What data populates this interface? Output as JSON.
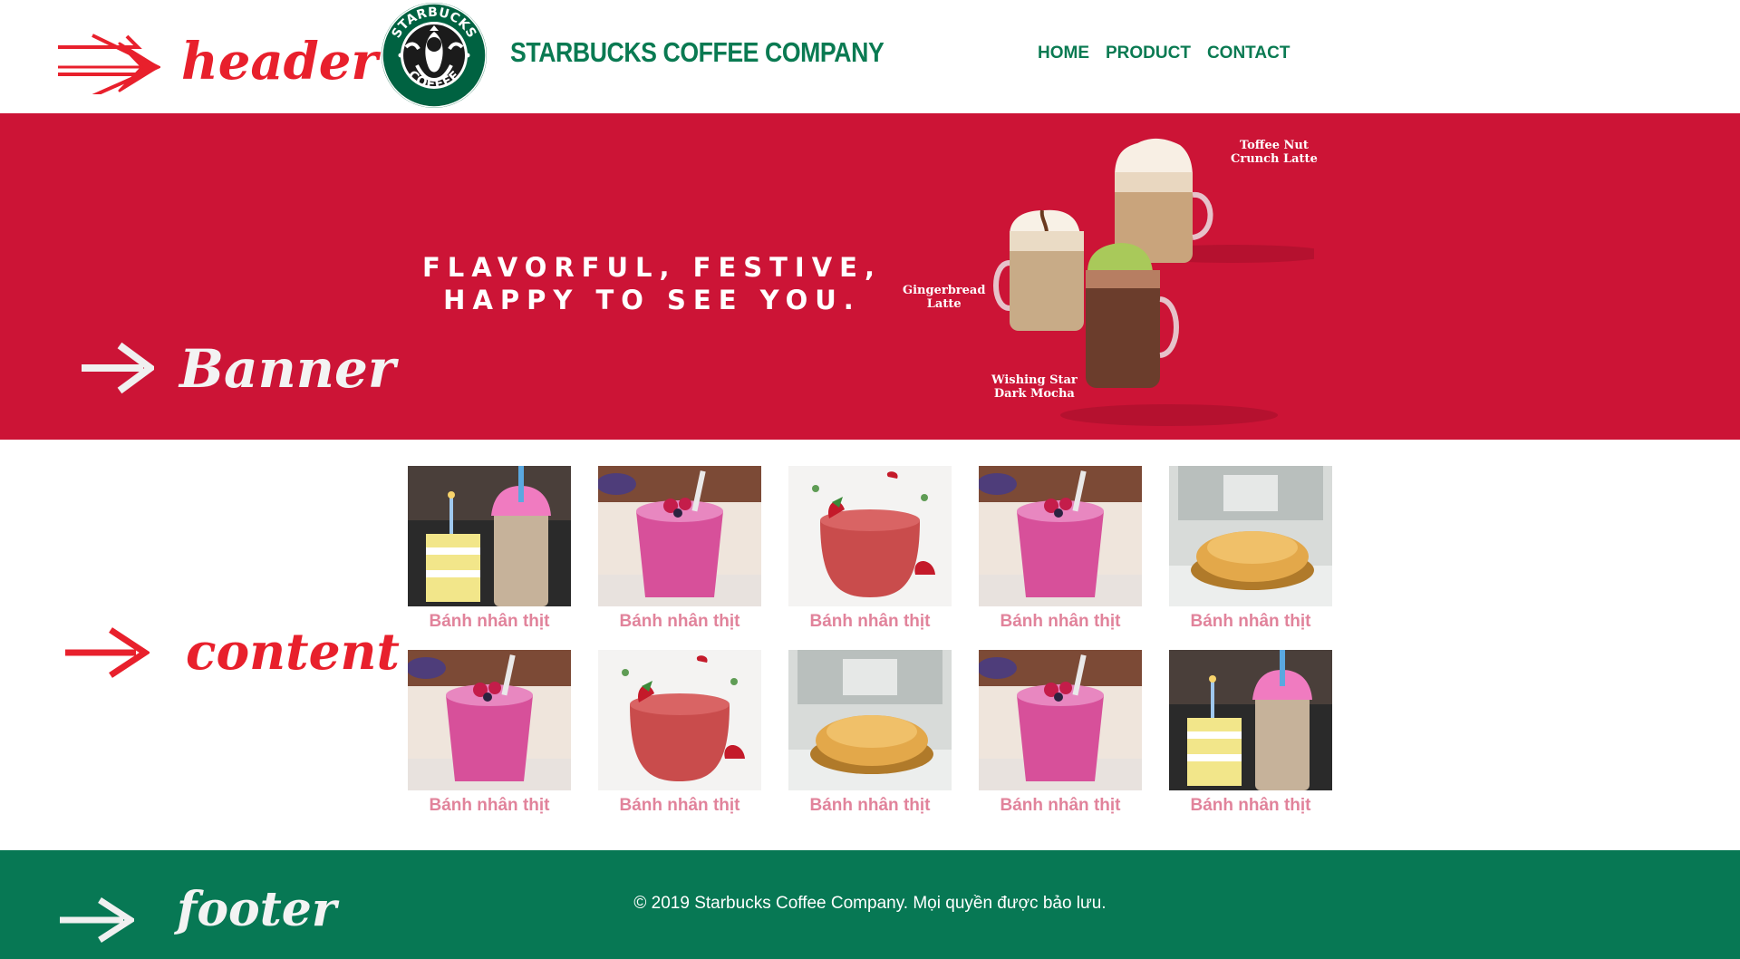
{
  "annotations": {
    "header": "header",
    "banner": "Banner",
    "content": "content",
    "footer": "footer"
  },
  "header": {
    "brand_name": "STARBUCKS COFFEE COMPANY",
    "logo": {
      "ring_text_top": "STARBUCKS",
      "ring_text_bottom": "COFFEE"
    },
    "nav": [
      "HOME",
      "PRODUCT",
      "CONTACT"
    ]
  },
  "banner": {
    "headline_line1": "FLAVORFUL, FESTIVE,",
    "headline_line2": "HAPPY TO SEE YOU.",
    "drinks": [
      {
        "line1": "Toffee Nut",
        "line2": "Crunch Latte"
      },
      {
        "line1": "Gingerbread",
        "line2": "Latte"
      },
      {
        "line1": "Wishing Star",
        "line2": "Dark Mocha"
      }
    ]
  },
  "content": {
    "products": [
      {
        "caption": "Bánh nhân thịt",
        "image": "milkshake-cake"
      },
      {
        "caption": "Bánh nhân thịt",
        "image": "berry-smoothie"
      },
      {
        "caption": "Bánh nhân thịt",
        "image": "strawberry-smoothie"
      },
      {
        "caption": "Bánh nhân thịt",
        "image": "berry-smoothie"
      },
      {
        "caption": "Bánh nhân thịt",
        "image": "pastry"
      },
      {
        "caption": "Bánh nhân thịt",
        "image": "berry-smoothie"
      },
      {
        "caption": "Bánh nhân thịt",
        "image": "strawberry-smoothie"
      },
      {
        "caption": "Bánh nhân thịt",
        "image": "pastry"
      },
      {
        "caption": "Bánh nhân thịt",
        "image": "berry-smoothie"
      },
      {
        "caption": "Bánh nhân thịt",
        "image": "milkshake-cake"
      }
    ]
  },
  "footer": {
    "copyright": "© 2019 Starbucks Coffee Company. Mọi quyền được bảo lưu."
  },
  "colors": {
    "brand_green": "#0a7a52",
    "banner_red": "#cc1436",
    "footer_green": "#077854",
    "caption_pink": "#e1839b",
    "annotation_red": "#e8202c"
  }
}
